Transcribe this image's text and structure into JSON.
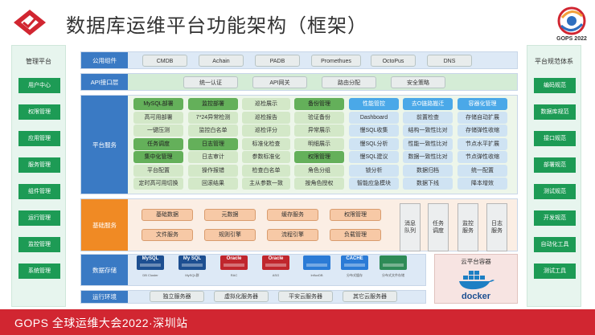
{
  "title": "数据库运维平台功能架构（框架）",
  "brand": {
    "logo_text": "GOPS 2022",
    "colors": {
      "accent_red": "#d12631",
      "accent_green": "#1d9b55",
      "accent_blue": "#3a7ac4"
    }
  },
  "left_panel": {
    "title": "管理平台",
    "items": [
      "用户中心",
      "权限管理",
      "应用管理",
      "服务管理",
      "组件管理",
      "运行管理",
      "监控管理",
      "系统管理"
    ]
  },
  "right_panel": {
    "title": "平台规范体系",
    "items": [
      "编码规范",
      "数据库规范",
      "接口规范",
      "部署规范",
      "测试规范",
      "开发规范",
      "自动化工具",
      "测试工具"
    ]
  },
  "layers": {
    "public": {
      "label": "公用组件",
      "items": [
        "CMDB",
        "Achain",
        "PADB",
        "Promethues",
        "OctoPus",
        "DNS"
      ]
    },
    "api": {
      "label": "API接口层",
      "items": [
        "统一认证",
        "API网关",
        "路由分配",
        "安全策略"
      ]
    },
    "platform": {
      "label": "平台服务",
      "grid": [
        [
          "MySQL部署",
          "监控部署",
          "巡检展示",
          "备份管理",
          "性能管控",
          "去O链路搬迁",
          "容器化管理"
        ],
        [
          "高可用部署",
          "7*24异常检测",
          "巡检报告",
          "验证备份",
          "Dashboard",
          "前置检查",
          "存储自动扩展"
        ],
        [
          "一键压测",
          "监控白名单",
          "巡检评分",
          "异常展示",
          "慢SQL收集",
          "结构一致性比对",
          "存储弹性收缩"
        ],
        [
          "任务调度",
          "日志管理",
          "标准化检查",
          "明细展示",
          "慢SQL分析",
          "性能一致性比对",
          "节点水平扩展"
        ],
        [
          "集中化管理",
          "日志审计",
          "参数标准化",
          "权限管理",
          "慢SQL建议",
          "数据一致性比对",
          "节点弹性收缩"
        ],
        [
          "平台配置",
          "操作报错",
          "检查白名单",
          "角色分组",
          "锁分析",
          "数据归档",
          "统一配置"
        ],
        [
          "定时高可用切换",
          "回滚结果",
          "主从参数一致",
          "按角色授权",
          "智能应急模块",
          "数据下线",
          "降本增效"
        ]
      ]
    },
    "base": {
      "label": "基础服务",
      "row1": [
        "基础数据",
        "元数据",
        "缓存服务",
        "权限管理"
      ],
      "row2": [
        "文件服务",
        "规则引擎",
        "流程引擎",
        "负载管理"
      ],
      "vertical": [
        "消息队列",
        "任务调度",
        "监控服务",
        "日志服务"
      ]
    },
    "storage": {
      "label": "数据存储",
      "items": [
        {
          "name": "MySQL",
          "caption": "DB Cluster"
        },
        {
          "name": "My SQL",
          "caption": "MySQL群"
        },
        {
          "name": "Oracle",
          "caption": "RAC"
        },
        {
          "name": "Oracle",
          "caption": "ASG"
        },
        {
          "name": "",
          "caption": "InfluxDB"
        },
        {
          "name": "CACHE",
          "caption": "分布式缓存"
        },
        {
          "name": "",
          "caption": "分布式文件存储"
        }
      ],
      "container_title": "云平台容器",
      "container_logo": "docker"
    },
    "runtime": {
      "label": "运行环境",
      "items": [
        "独立服务器",
        "虚拟化服务器",
        "平安云服务器",
        "其它云服务器"
      ]
    }
  },
  "footer": {
    "text": "GOPS 全球运维大会2022·深圳站"
  }
}
